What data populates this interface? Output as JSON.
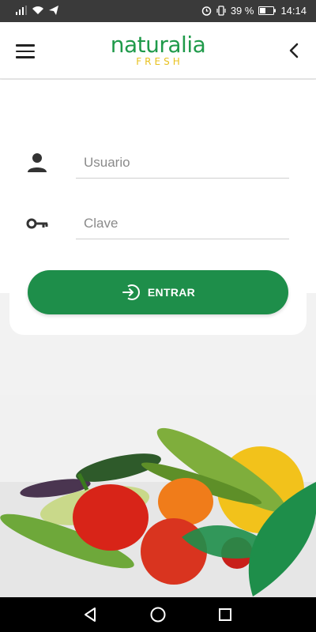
{
  "status_bar": {
    "battery_percent": "39 %",
    "time": "14:14"
  },
  "header": {
    "logo_main": "naturalia",
    "logo_sub": "FRESH"
  },
  "form": {
    "user_placeholder": "Usuario",
    "password_placeholder": "Clave",
    "submit_label": "ENTRAR"
  },
  "colors": {
    "brand_green": "#1e8e4a",
    "logo_yellow": "#e8c11f",
    "status_bar_bg": "#3a3a3a"
  },
  "icons": {
    "menu": "hamburger-icon",
    "back": "chevron-left-icon",
    "user": "person-icon",
    "password": "key-icon",
    "login": "sign-in-arrow-icon"
  }
}
